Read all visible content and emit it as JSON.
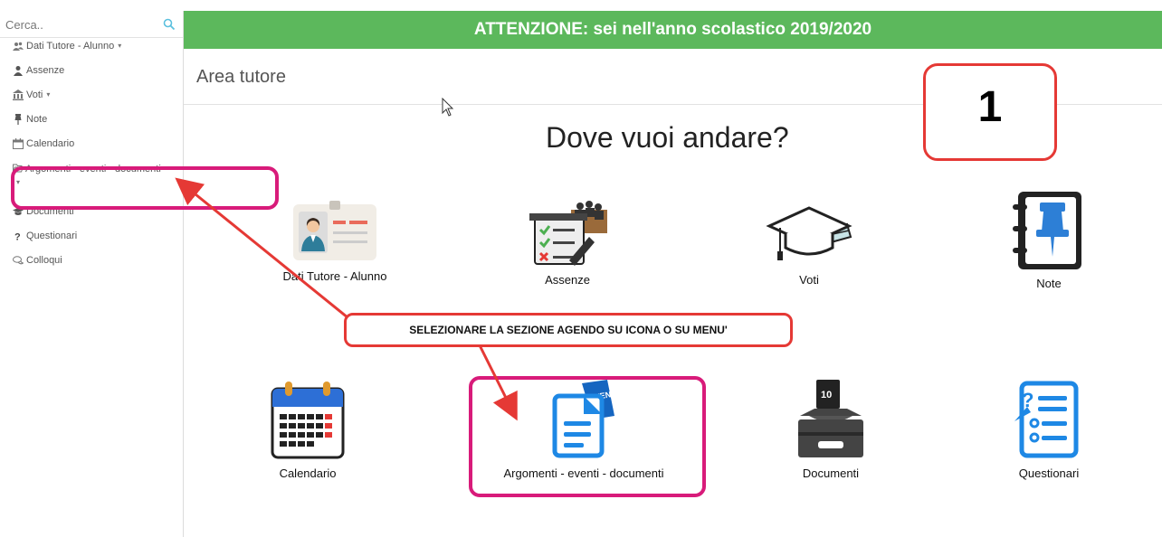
{
  "sidebar": {
    "search_placeholder": "Cerca..",
    "items": [
      {
        "label": "Dati Tutore - Alunno",
        "icon": "users-icon",
        "caret": "▾"
      },
      {
        "label": "Assenze",
        "icon": "user-icon",
        "caret": ""
      },
      {
        "label": "Voti",
        "icon": "bank-icon",
        "caret": "▾"
      },
      {
        "label": "Note",
        "icon": "pin-icon",
        "caret": ""
      },
      {
        "label": "Calendario",
        "icon": "calendar-icon",
        "caret": ""
      },
      {
        "label": "Argomenti - eventi - documenti",
        "icon": "folder-open-icon",
        "caret": "▾"
      },
      {
        "label": "Documenti",
        "icon": "graduation-cap-icon",
        "caret": ""
      },
      {
        "label": "Questionari",
        "icon": "question-icon",
        "caret": ""
      },
      {
        "label": "Colloqui",
        "icon": "chat-icon",
        "caret": ""
      }
    ]
  },
  "banner": {
    "text": "ATTENZIONE: sei nell'anno scolastico 2019/2020",
    "color": "#5cb85c"
  },
  "header": {
    "title": "Area tutore"
  },
  "main": {
    "question": "Dove vuoi andare?",
    "tiles": [
      {
        "label": "Dati Tutore - Alunno",
        "icon": "id-card-icon"
      },
      {
        "label": "Assenze",
        "icon": "checklist-icon"
      },
      {
        "label": "Voti",
        "icon": "graduation-cap-icon"
      },
      {
        "label": "Note",
        "icon": "notebook-pin-icon"
      },
      {
        "label": "Calendario",
        "icon": "calendar-icon"
      },
      {
        "label": "Argomenti - eventi - documenti",
        "icon": "document-event-icon"
      },
      {
        "label": "Documenti",
        "icon": "document-tray-icon"
      },
      {
        "label": "Questionari",
        "icon": "questionnaire-icon"
      }
    ]
  },
  "annotations": {
    "step_number": "1",
    "callout": "SELEZIONARE LA SEZIONE AGENDO SU ICONA O SU MENU'",
    "arrow_color": "#e53935",
    "highlight_color": "#d81b7a"
  }
}
